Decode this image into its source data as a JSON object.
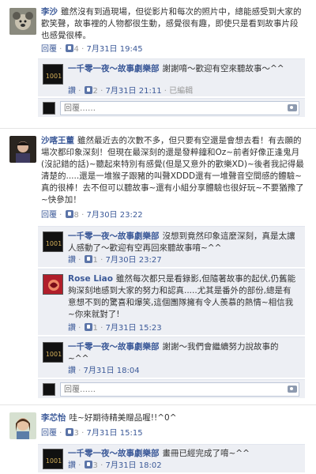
{
  "labels": {
    "reply": "回覆",
    "like": "讚",
    "reply_placeholder": "回覆……",
    "edited": "已編輯"
  },
  "comments": [
    {
      "author": "李沙",
      "text": "雖然沒有到過現場，但從影片和每次的照片中，總能感受到大家的歡笑聲，故事裡的人物都很生動，感覺很有趣，即使只是看到故事片段也感覺很棒。",
      "likes": "4",
      "time": "7月31日 19:45",
      "replies": [
        {
          "author": "一千零一夜～故事劇樂部",
          "text": "謝謝唷～歡迎有空來聽故事～^^",
          "likes": "2",
          "time": "7月31日 21:11",
          "edited": true
        }
      ]
    },
    {
      "author": "沙喀王董",
      "text": "雖然最近去的次數不多，但只要有空還是會想去看！有去願的場次都印象深刻！但現在最深刻的還是發粹鐘和Oz~前者好像正逢鬼月(沒記錯的話)~聽起來特別有感覺(但是又意外的歡樂XD)~後者我記得最清楚的.....還是一堆猴子跟豬的叫聲XDDD還有一堆聲音空間感的體驗~真的很棒！去不但可以聽故事~還有小組分享體驗也很好玩~不要猶豫了~快參加！",
      "likes": "8",
      "time": "7月30日 23:22",
      "replies": [
        {
          "author": "一千零一夜～故事劇樂部",
          "text": "沒想到竟然印象這麼深刻，真是太讓人感動了～歡迎有空再回來聽故事唷~^^",
          "likes": "1",
          "time": "7月30日 23:27",
          "edited": false
        },
        {
          "author": "Rose Liao",
          "text": "雖然每次都只是看錄影,但隨著故事的起伏,仍舊能夠深刻地感到大家的努力和認真.....尤其是番外的部份,總是有意想不到的驚喜和爆笑,這個團隊擁有令人羨慕的熱情~相信我~你來就對了!",
          "likes": "1",
          "time": "7月31日 15:23",
          "edited": false
        },
        {
          "author": "一千零一夜～故事劇樂部",
          "text": "謝謝～我們會繼續努力說故事的~^^",
          "likes": "",
          "time": "7月31日 18:04",
          "edited": false
        }
      ]
    },
    {
      "author": "李芯怡",
      "text": "哇~好期待精美贈品喔!!^0^",
      "likes": "3",
      "time": "7月31日 15:15",
      "replies": [
        {
          "author": "一千零一夜～故事劇樂部",
          "text": "畫冊已經完成了唷~^^",
          "likes": "3",
          "time": "7月31日 18:02",
          "edited": false
        }
      ]
    }
  ]
}
